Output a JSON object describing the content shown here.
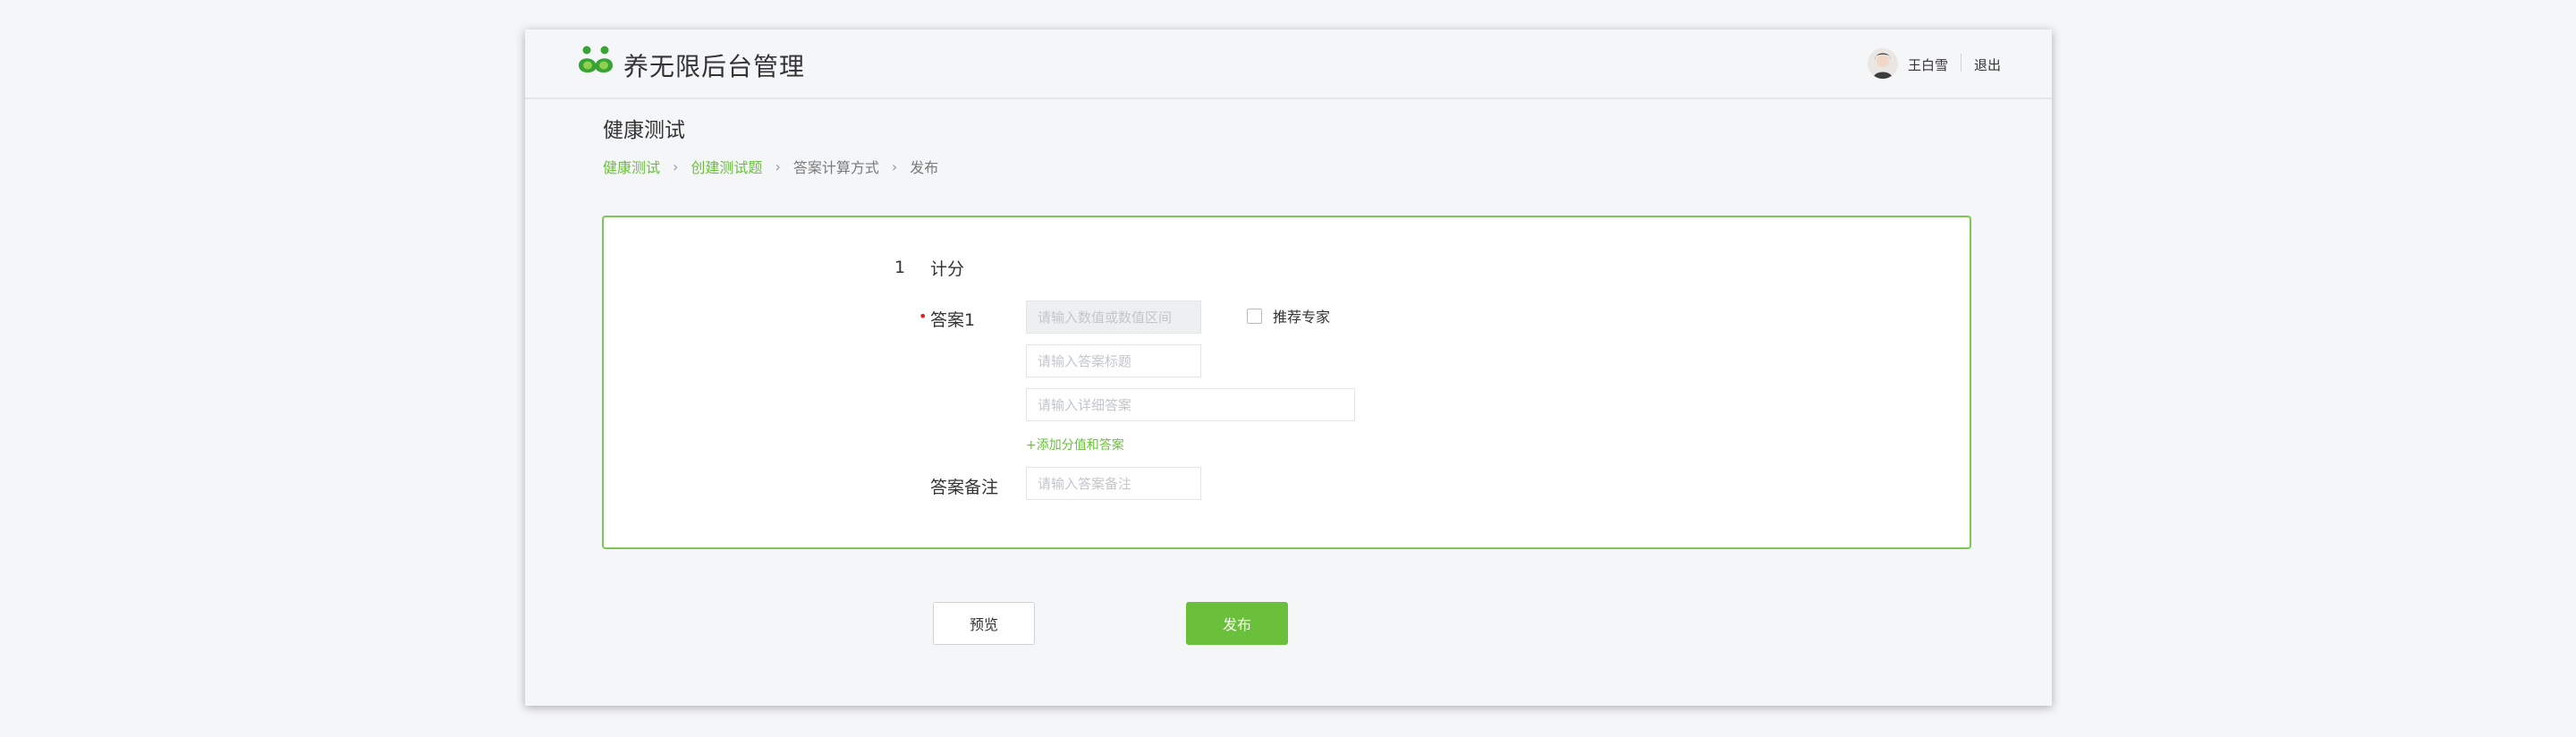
{
  "header": {
    "app_title": "养无限后台管理",
    "user_name": "王白雪",
    "logout_label": "退出",
    "logo_icon": "twin-sprout-logo-icon",
    "avatar_icon": "user-avatar"
  },
  "page": {
    "title": "健康测试",
    "breadcrumb": [
      "健康测试",
      "创建测试题",
      "答案计算方式",
      "发布"
    ]
  },
  "form": {
    "question_number": "1",
    "question_title": "计分",
    "answer_label": "答案1",
    "score_placeholder": "请输入数值或数值区间",
    "answer_title_placeholder": "请输入答案标题",
    "answer_detail_placeholder": "请输入详细答案",
    "recommend_label": "推荐专家",
    "recommend_checked": false,
    "add_link": "+添加分值和答案",
    "note_label": "答案备注",
    "note_placeholder": "请输入答案备注"
  },
  "actions": {
    "preview_label": "预览",
    "publish_label": "发布"
  },
  "colors": {
    "accent": "#6abf3b",
    "panel_border": "#7dc855",
    "required": "#e02020"
  }
}
